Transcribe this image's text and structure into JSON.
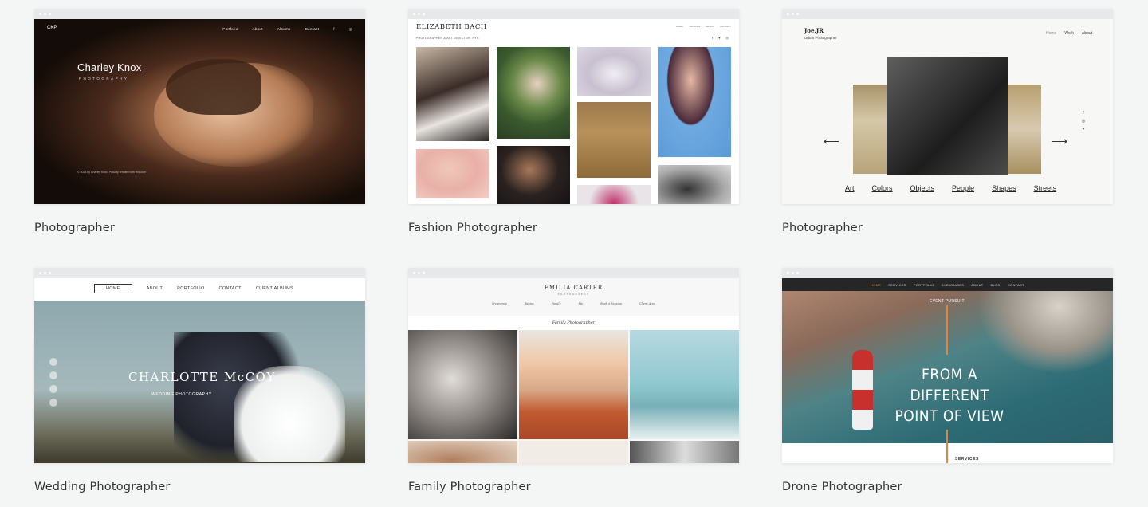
{
  "cards": [
    {
      "caption": "Photographer",
      "preview": {
        "brand": "CKP",
        "nav": [
          "Portfolio",
          "About",
          "Albums",
          "Contact"
        ],
        "name": "Charley Knox",
        "subtitle": "PHOTOGRAPHY",
        "footer": "© 2023 by Charley Knox. Proudly created with Wix.com"
      }
    },
    {
      "caption": "Fashion Photographer",
      "preview": {
        "name": "ELIZABETH BACH",
        "subtitle": "PHOTOGRAPHER & ART DIRECTOR, NYC",
        "nav": [
          "WORK",
          "JOURNAL",
          "ABOUT",
          "CONTACT"
        ]
      }
    },
    {
      "caption": "Photographer",
      "preview": {
        "logo": "Joe.JR",
        "logo_sub": "Urban Photographer",
        "nav": [
          "Home",
          "Work",
          "About"
        ],
        "categories": [
          "Art",
          "Colors",
          "Objects",
          "People",
          "Shapes",
          "Streets"
        ],
        "arrow_left": "⟵",
        "arrow_right": "⟶"
      }
    },
    {
      "caption": "Wedding Photographer",
      "preview": {
        "nav": [
          "HOME",
          "ABOUT",
          "PORTFOLIO",
          "CONTACT",
          "CLIENT ALBUMS"
        ],
        "title": "CHARLOTTE McCOY",
        "subtitle": "WEDDING PHOTOGRAPHY"
      }
    },
    {
      "caption": "Family Photographer",
      "preview": {
        "name": "EMILIA CARTER",
        "subtitle": "PHOTOGRAPHY",
        "nav": [
          "Pregnancy",
          "Babies",
          "Family",
          "Me",
          "Book a Session",
          "Client Area"
        ],
        "section": "Family Photographer"
      }
    },
    {
      "caption": "Drone Photographer",
      "preview": {
        "nav": [
          "HOME",
          "SERVICES",
          "PORTFOLIO",
          "SHOWCASES",
          "ABOUT",
          "BLOG",
          "CONTACT"
        ],
        "event": "EVENT PURSUIT",
        "hero_line1": "FROM A DIFFERENT",
        "hero_line2": "POINT OF VIEW",
        "services": "SERVICES"
      }
    }
  ],
  "colors": {
    "background": "#f4f5f5",
    "accent_orange": "#e8823a"
  }
}
